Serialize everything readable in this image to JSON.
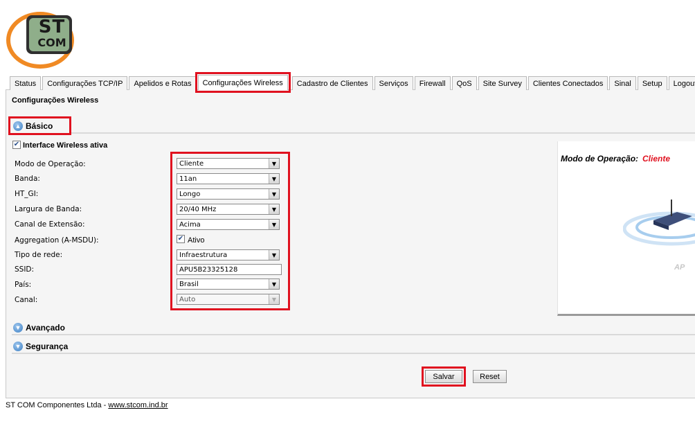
{
  "logo": {
    "text_top": "ST",
    "text_bottom": "COM"
  },
  "tabs": [
    {
      "label": "Status"
    },
    {
      "label": "Configurações TCP/IP"
    },
    {
      "label": "Apelidos e Rotas"
    },
    {
      "label": "Configurações Wireless"
    },
    {
      "label": "Cadastro de Clientes"
    },
    {
      "label": "Serviços"
    },
    {
      "label": "Firewall"
    },
    {
      "label": "QoS"
    },
    {
      "label": "Site Survey"
    },
    {
      "label": "Clientes Conectados"
    },
    {
      "label": "Sinal"
    },
    {
      "label": "Setup"
    },
    {
      "label": "Logout"
    }
  ],
  "page_title": "Configurações Wireless",
  "sections": {
    "basic": "Básico",
    "advanced": "Avançado",
    "security": "Segurança"
  },
  "wireless_active": {
    "label": "Interface Wireless ativa",
    "checked": true
  },
  "fields": {
    "mode": {
      "label": "Modo de Operação:",
      "value": "Cliente"
    },
    "band": {
      "label": "Banda:",
      "value": "11an"
    },
    "ht_gi": {
      "label": "HT_GI:",
      "value": "Longo"
    },
    "bandwidth": {
      "label": "Largura de Banda:",
      "value": "20/40 MHz"
    },
    "ext_channel": {
      "label": "Canal de Extensão:",
      "value": "Acima"
    },
    "aggregation": {
      "label": "Aggregation (A-MSDU):",
      "checkbox_label": "Ativo",
      "checked": true
    },
    "network_type": {
      "label": "Tipo de rede:",
      "value": "Infraestrutura"
    },
    "ssid": {
      "label": "SSID:",
      "value": "APU5B23325128"
    },
    "country": {
      "label": "País:",
      "value": "Brasil"
    },
    "channel": {
      "label": "Canal:",
      "value": "Auto"
    }
  },
  "mode_panel": {
    "label": "Modo de Operação:",
    "value": "Cliente",
    "device_label": "AP"
  },
  "buttons": {
    "save": "Salvar",
    "reset": "Reset"
  },
  "footer": {
    "company": "ST COM Componentes Ltda - ",
    "link": "www.stcom.ind.br"
  },
  "colors": {
    "highlight": "#e0111f",
    "mode_value": "#e0111f",
    "logo_orange": "#f08a24"
  }
}
